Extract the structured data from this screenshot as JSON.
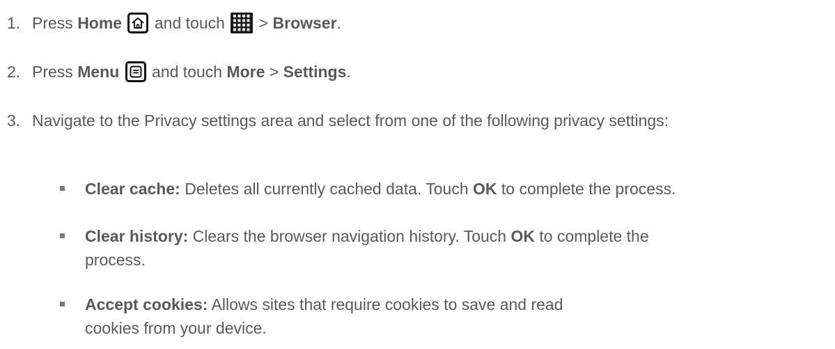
{
  "steps": [
    {
      "number": "1.",
      "parts": {
        "t1": "Press ",
        "b1": "Home",
        "t2": " and touch ",
        "t3": " > ",
        "b2": "Browser",
        "t4": "."
      }
    },
    {
      "number": "2.",
      "parts": {
        "t1": "Press ",
        "b1": "Menu",
        "t2": " and touch ",
        "b2": "More",
        "t3": " > ",
        "b3": "Settings",
        "t4": "."
      }
    },
    {
      "number": "3.",
      "text": "Navigate to the Privacy settings area and select from one of the following privacy settings:"
    }
  ],
  "bullets": [
    {
      "term": "Clear cache:",
      "desc1": " Deletes all currently cached data. Touch ",
      "ok": "OK",
      "desc2": " to complete the process."
    },
    {
      "term": "Clear history:",
      "desc1": " Clears the browser navigation history. Touch ",
      "ok": "OK",
      "desc2": " to complete the process."
    },
    {
      "term": "Accept cookies:",
      "desc1": " Allows sites that require cookies to save and read cookies from your device."
    }
  ],
  "icons": {
    "home": "home-icon",
    "apps": "apps-grid-icon",
    "menu": "menu-icon"
  },
  "colors": {
    "text": "#595959",
    "icon": "#111111",
    "bullet": "#7a7a7a"
  }
}
